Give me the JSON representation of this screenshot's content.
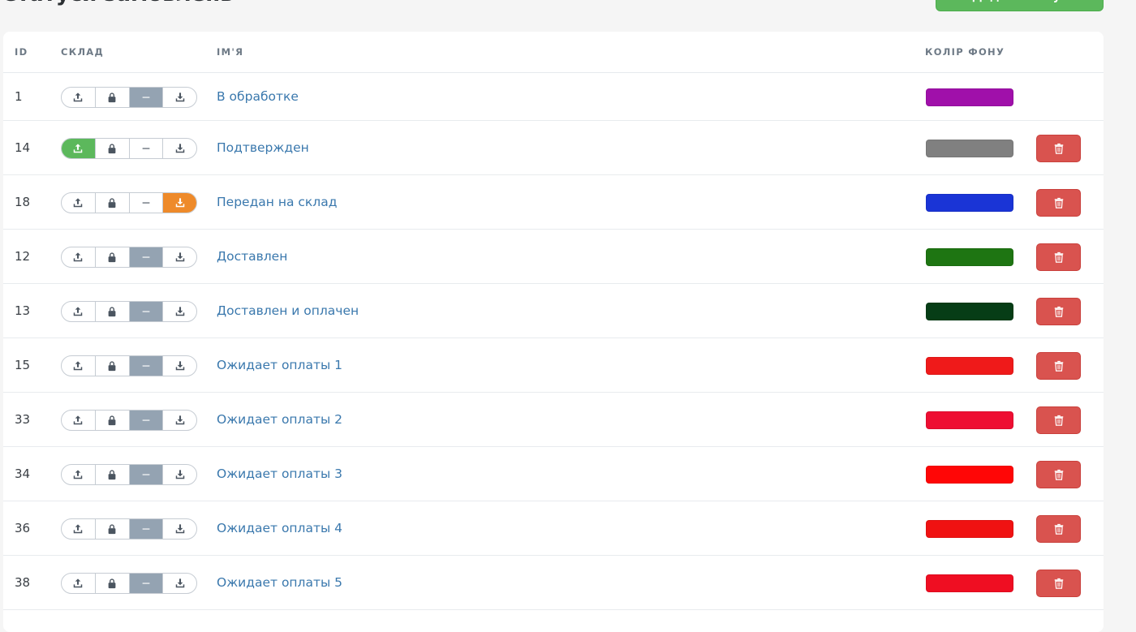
{
  "page": {
    "title": "Статуси замовлень",
    "add_button_label": "Додати статус"
  },
  "table": {
    "headers": {
      "id": "ID",
      "warehouse": "СКЛАД",
      "name": "ІМ'Я",
      "bg_color": "КОЛІР ФОНУ"
    },
    "warehouse_segments": [
      "upload-icon",
      "lock-icon",
      "dash-icon",
      "download-icon"
    ],
    "rows": [
      {
        "id": "1",
        "name": "В обработке",
        "warehouse_state": "none",
        "color": "#a010aa",
        "deletable": false
      },
      {
        "id": "14",
        "name": "Подтвержден",
        "warehouse_state": "upload",
        "color": "#808080",
        "deletable": true
      },
      {
        "id": "18",
        "name": "Передан на склад",
        "warehouse_state": "download",
        "color": "#1a34d6",
        "deletable": true
      },
      {
        "id": "12",
        "name": "Доставлен",
        "warehouse_state": "none",
        "color": "#1e7512",
        "deletable": true
      },
      {
        "id": "13",
        "name": "Доставлен и оплачен",
        "warehouse_state": "none",
        "color": "#063d16",
        "deletable": true
      },
      {
        "id": "15",
        "name": "Ожидает оплаты 1",
        "warehouse_state": "none",
        "color": "#ef1a1a",
        "deletable": true
      },
      {
        "id": "33",
        "name": "Ожидает оплаты 2",
        "warehouse_state": "none",
        "color": "#ee0e32",
        "deletable": true
      },
      {
        "id": "34",
        "name": "Ожидает оплаты 3",
        "warehouse_state": "none",
        "color": "#ff0606",
        "deletable": true
      },
      {
        "id": "36",
        "name": "Ожидает оплаты 4",
        "warehouse_state": "none",
        "color": "#f01212",
        "deletable": true
      },
      {
        "id": "38",
        "name": "Ожидает оплаты 5",
        "warehouse_state": "none",
        "color": "#ef0e22",
        "deletable": true
      }
    ]
  },
  "colors": {
    "accent_green": "#5cb85c",
    "accent_orange": "#ee8a2a",
    "neutral_active": "#94a3b2",
    "danger": "#d9534f",
    "link": "#3a78ad"
  }
}
